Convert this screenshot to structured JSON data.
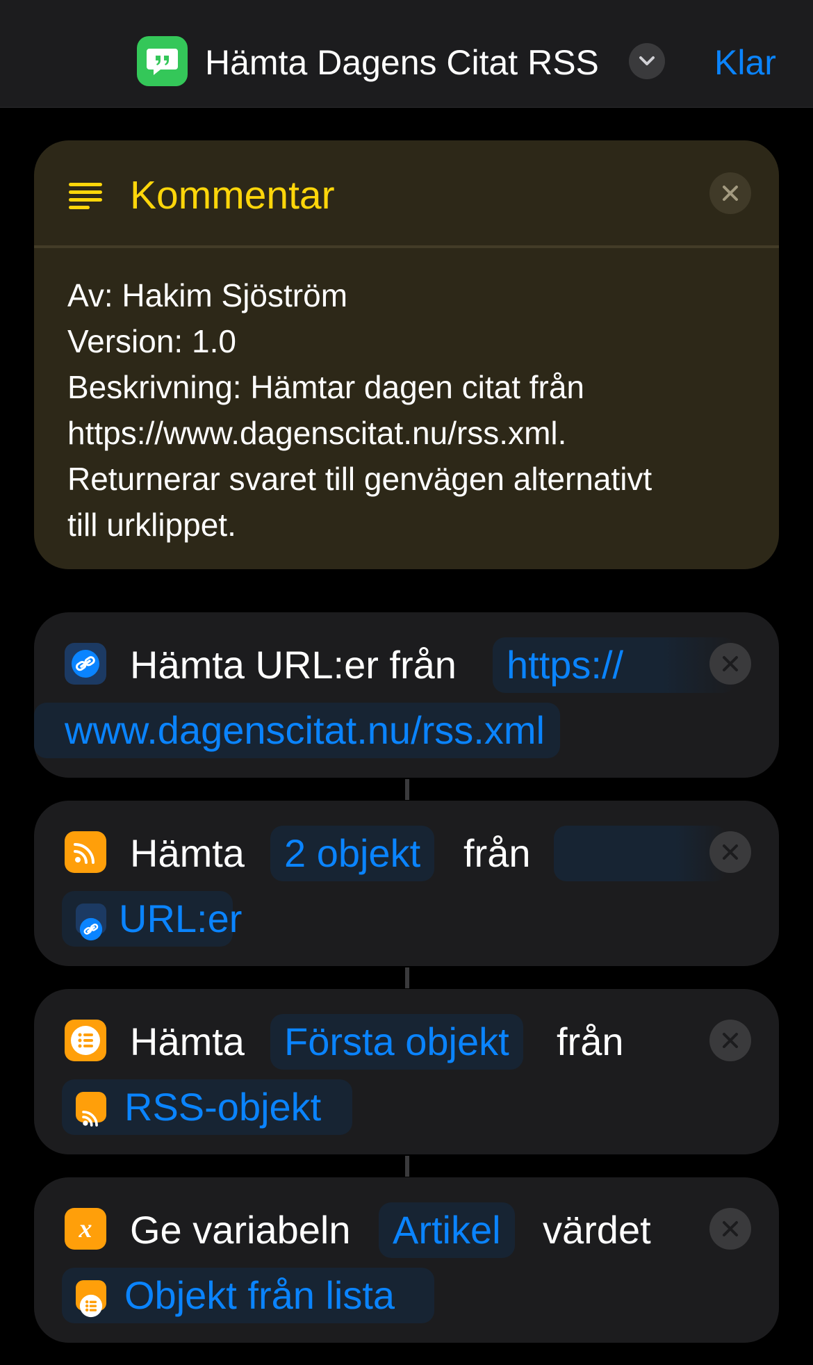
{
  "header": {
    "title": "Hämta Dagens Citat RSS",
    "done_label": "Klar",
    "app_icon": "speech-bubble-quote-icon",
    "app_icon_color": "#34c759"
  },
  "comment": {
    "title": "Kommentar",
    "lines": [
      "Av: Hakim Sjöström",
      "Version: 1.0",
      "Beskrivning: Hämtar dagen citat från",
      "https://www.dagenscitat.nu/rss.xml.",
      "Returnerar svaret till genvägen alternativt",
      "till urklippet."
    ]
  },
  "actions": [
    {
      "icon": "link-icon",
      "color": "#0a84ff",
      "label": "Hämta URL:er från",
      "url_part1": "https://",
      "url_part2": "www.dagenscitat.nu/rss.xml"
    },
    {
      "icon": "rss-icon",
      "color": "#ff9f0a",
      "label": "Hämta",
      "count": "2 objekt",
      "from": "från",
      "source": "URL:er"
    },
    {
      "icon": "list-icon",
      "color": "#ff9f0a",
      "label": "Hämta",
      "which": "Första objekt",
      "from": "från",
      "source": "RSS-objekt"
    },
    {
      "icon": "variable-icon",
      "color": "#ff9f0a",
      "label": "Ge variabeln",
      "variable": "Artikel",
      "value_label": "värdet",
      "source": "Objekt från lista"
    }
  ]
}
